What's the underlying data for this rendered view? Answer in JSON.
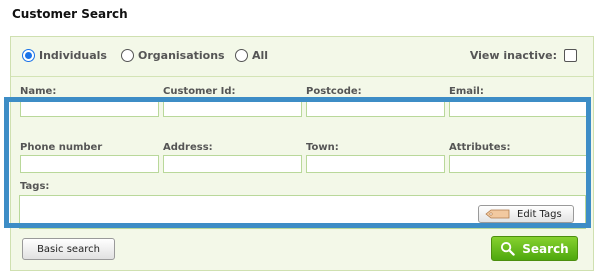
{
  "page": {
    "title": "Customer Search"
  },
  "type_filter": {
    "options": [
      {
        "label": "Individuals",
        "selected": true
      },
      {
        "label": "Organisations",
        "selected": false
      },
      {
        "label": "All",
        "selected": false
      }
    ],
    "view_inactive_label": "View inactive:",
    "view_inactive_checked": false
  },
  "fields": {
    "name": {
      "label": "Name:",
      "value": ""
    },
    "customer_id": {
      "label": "Customer Id:",
      "value": ""
    },
    "postcode": {
      "label": "Postcode:",
      "value": ""
    },
    "email": {
      "label": "Email:",
      "value": ""
    },
    "phone": {
      "label": "Phone number",
      "value": ""
    },
    "address": {
      "label": "Address:",
      "value": ""
    },
    "town": {
      "label": "Town:",
      "value": ""
    },
    "attributes": {
      "label": "Attributes:",
      "value": ""
    },
    "tags": {
      "label": "Tags:"
    }
  },
  "buttons": {
    "edit_tags": "Edit Tags",
    "basic_search": "Basic search",
    "search": "Search"
  },
  "colors": {
    "panel_bg": "#f3f8e8",
    "highlight_border": "#3d8dc6",
    "search_green": "#5fb61a",
    "radio_selected": "#1a73e8"
  }
}
